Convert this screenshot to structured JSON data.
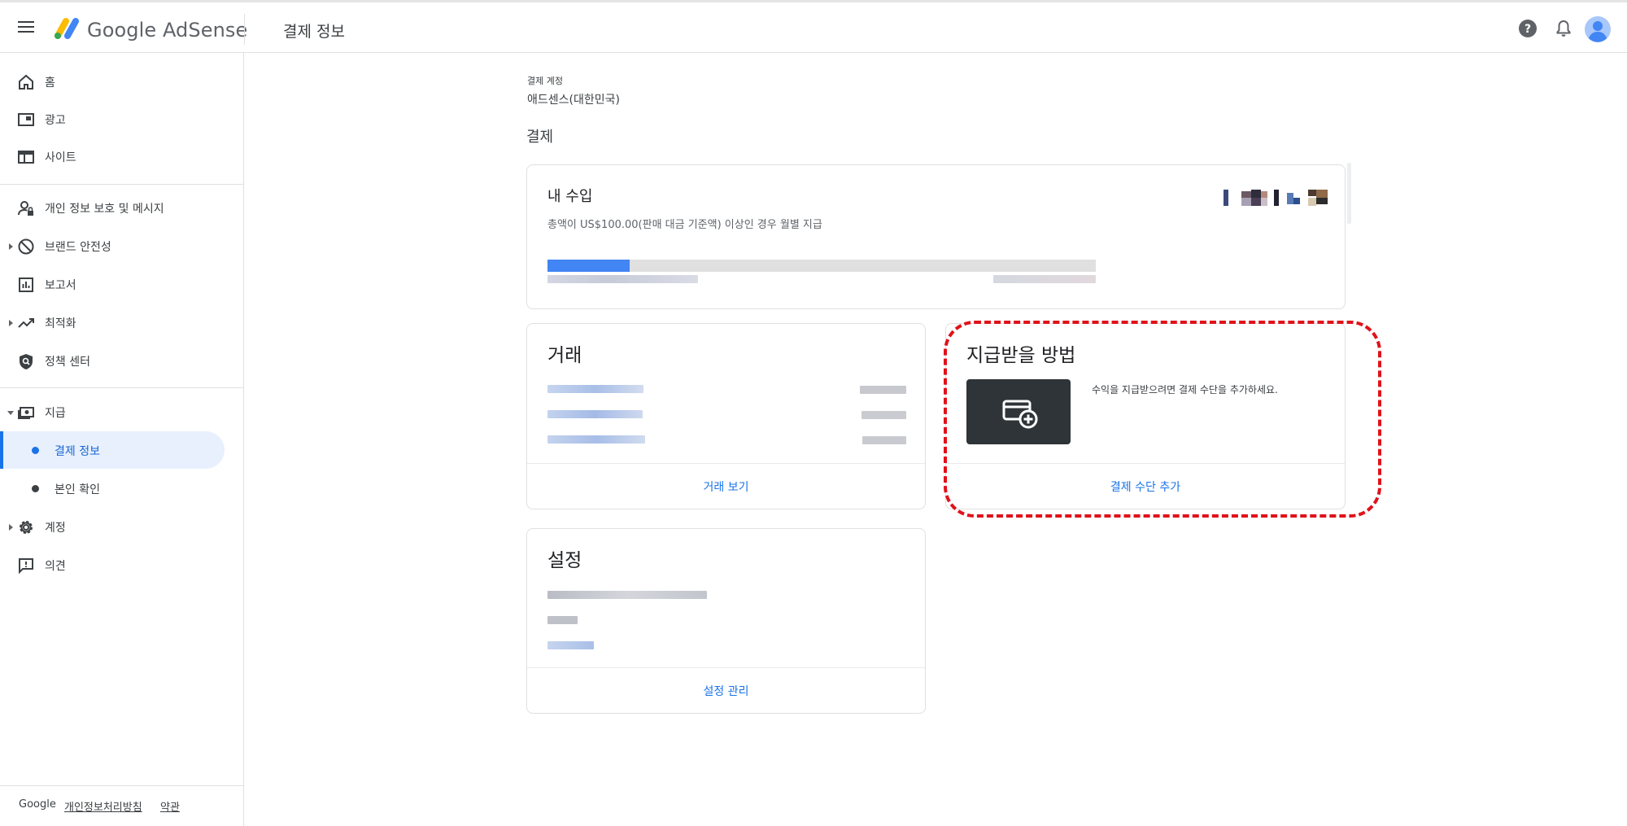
{
  "header": {
    "brand": "Google AdSense",
    "page_title": "결제 정보",
    "icons": [
      "menu-icon",
      "help-icon",
      "bell-icon",
      "account-avatar-icon"
    ]
  },
  "sidebar": {
    "items": [
      {
        "label": "홈",
        "icon": "home-icon"
      },
      {
        "label": "광고",
        "icon": "ads-icon"
      },
      {
        "label": "사이트",
        "icon": "sites-icon"
      },
      {
        "label": "개인 정보 보호 및 메시지",
        "icon": "privacy-icon"
      },
      {
        "label": "브랜드 안전성",
        "icon": "block-icon"
      },
      {
        "label": "보고서",
        "icon": "report-icon"
      },
      {
        "label": "최적화",
        "icon": "trending-icon"
      },
      {
        "label": "정책 센터",
        "icon": "shield-icon"
      },
      {
        "label": "지급",
        "icon": "payments-icon"
      },
      {
        "label": "계정",
        "icon": "gear-icon"
      },
      {
        "label": "의견",
        "icon": "feedback-icon"
      }
    ],
    "sub_items": [
      {
        "label": "결제 정보"
      },
      {
        "label": "본인 확인"
      }
    ],
    "footer": {
      "google": "Google",
      "privacy": "개인정보처리방침",
      "terms": "약관"
    }
  },
  "main": {
    "account_label": "결제 계정",
    "account_value": "애드센스(대한민국)",
    "section_title": "결제",
    "earnings": {
      "title": "내 수입",
      "description": "총액이 US$100.00(판매 대금 기준액) 이상인 경우 월별 지급",
      "progress": 0.15
    },
    "transactions": {
      "title": "거래",
      "link": "거래 보기"
    },
    "payment_method": {
      "title": "지급받을 방법",
      "hint": "수익을 지급받으려면 결제 수단을 추가하세요.",
      "link": "결제 수단 추가"
    },
    "settings": {
      "title": "설정",
      "link": "설정 관리"
    }
  },
  "colors": {
    "accent": "#1a73e8",
    "highlight": "#e0121a",
    "progress": "#4285f4"
  }
}
